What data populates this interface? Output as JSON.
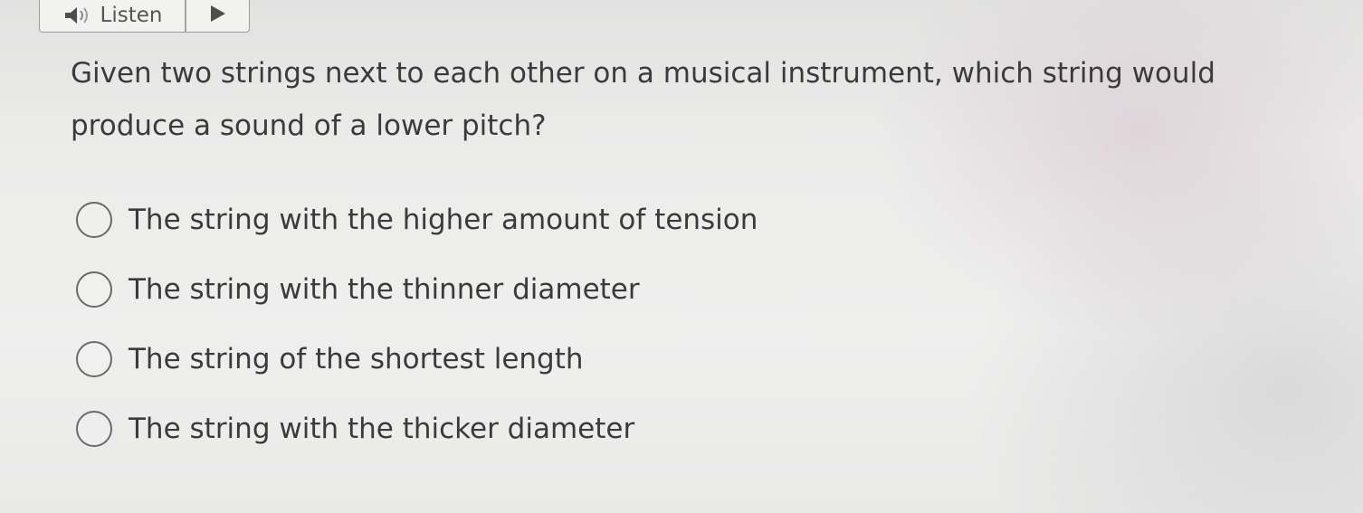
{
  "toolbar": {
    "listen_label": "Listen",
    "listen_icon": "speaker-icon",
    "play_icon": "play-icon",
    "accent_color": "#5a5a5a"
  },
  "question": {
    "text": "Given two strings next to each other on a musical instrument, which string would produce a sound of a lower pitch?"
  },
  "options": [
    {
      "label": "The string with the higher amount of tension",
      "selected": false
    },
    {
      "label": "The string with the thinner diameter",
      "selected": false
    },
    {
      "label": "The string of the shortest length",
      "selected": false
    },
    {
      "label": "The string with the thicker diameter",
      "selected": false
    }
  ]
}
